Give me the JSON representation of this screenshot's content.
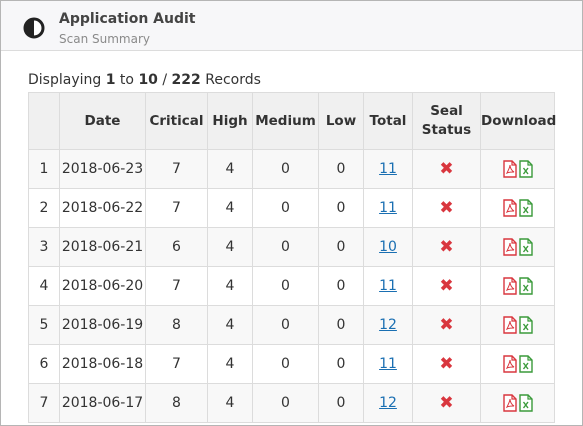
{
  "header": {
    "title": "Application Audit",
    "subtitle": "Scan Summary",
    "icon": "contrast-icon"
  },
  "records": {
    "prefix": "Displaying",
    "from": "1",
    "to_word": "to",
    "to": "10",
    "separator": "/",
    "total": "222",
    "suffix": "Records"
  },
  "table": {
    "columns": [
      "",
      "Date",
      "Critical",
      "High",
      "Medium",
      "Low",
      "Total",
      "Seal Status",
      "Download"
    ],
    "rows": [
      {
        "n": "1",
        "date": "2018-06-23",
        "critical": "7",
        "high": "4",
        "medium": "0",
        "low": "0",
        "total": "11",
        "seal_status": "fail"
      },
      {
        "n": "2",
        "date": "2018-06-22",
        "critical": "7",
        "high": "4",
        "medium": "0",
        "low": "0",
        "total": "11",
        "seal_status": "fail"
      },
      {
        "n": "3",
        "date": "2018-06-21",
        "critical": "6",
        "high": "4",
        "medium": "0",
        "low": "0",
        "total": "10",
        "seal_status": "fail"
      },
      {
        "n": "4",
        "date": "2018-06-20",
        "critical": "7",
        "high": "4",
        "medium": "0",
        "low": "0",
        "total": "11",
        "seal_status": "fail"
      },
      {
        "n": "5",
        "date": "2018-06-19",
        "critical": "8",
        "high": "4",
        "medium": "0",
        "low": "0",
        "total": "12",
        "seal_status": "fail"
      },
      {
        "n": "6",
        "date": "2018-06-18",
        "critical": "7",
        "high": "4",
        "medium": "0",
        "low": "0",
        "total": "11",
        "seal_status": "fail"
      },
      {
        "n": "7",
        "date": "2018-06-17",
        "critical": "8",
        "high": "4",
        "medium": "0",
        "low": "0",
        "total": "12",
        "seal_status": "fail"
      }
    ]
  },
  "colors": {
    "link": "#1a6fb2",
    "fail": "#d9363e",
    "pdf": "#d9363e",
    "excel": "#3a9a3a"
  }
}
